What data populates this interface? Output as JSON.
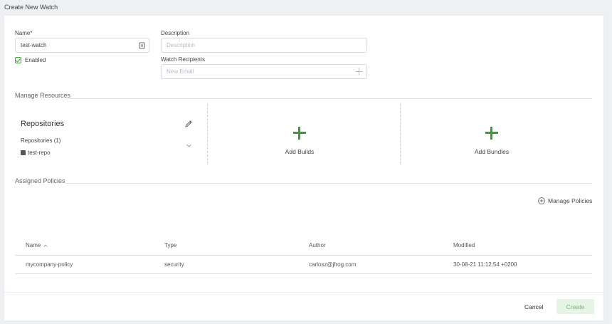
{
  "page": {
    "title": "Create New Watch"
  },
  "form": {
    "name_label": "Name*",
    "name_value": "test-watch",
    "enabled_label": "Enabled",
    "description_label": "Description",
    "description_placeholder": "Description",
    "recipients_label": "Watch Recipients",
    "recipients_placeholder": "New Email"
  },
  "resources": {
    "section_title": "Manage Resources",
    "repositories": {
      "title": "Repositories",
      "group_label": "Repositories (1)",
      "items": [
        "test-repo"
      ]
    },
    "add_builds_label": "Add Builds",
    "add_bundles_label": "Add Bundles"
  },
  "policies": {
    "section_title": "Assigned Policies",
    "manage_label": "Manage Policies",
    "columns": [
      "Name",
      "Type",
      "Author",
      "Modified"
    ],
    "rows": [
      {
        "name": "mycompany-policy",
        "type": "security",
        "author": "carlosz@jfrog.com",
        "modified": "30-08-21 11:12:54 +0200"
      }
    ]
  },
  "footer": {
    "cancel_label": "Cancel",
    "create_label": "Create"
  },
  "colors": {
    "accent_green": "#3c9a3b",
    "create_bg": "#e6f4e6",
    "create_text": "#6bbd6b"
  }
}
